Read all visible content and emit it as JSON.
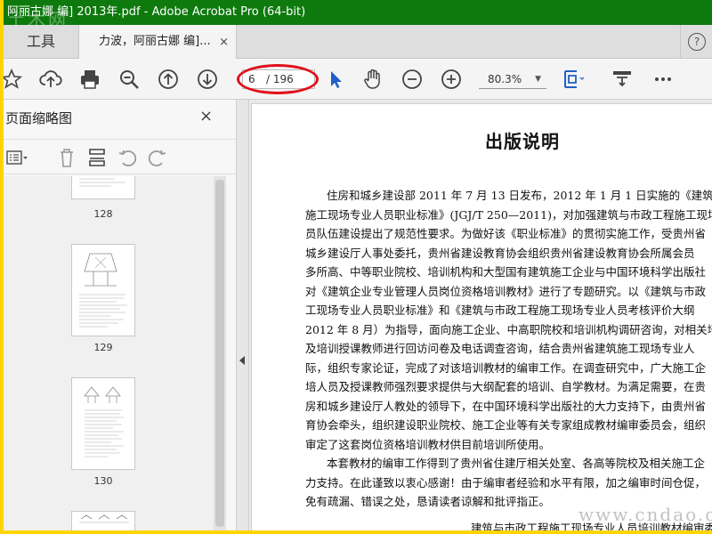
{
  "window": {
    "title": "阿丽古娜 编] 2013年.pdf - Adobe Acrobat Pro (64-bit)",
    "watermark_top": "土木网",
    "watermark_bottom": "www.cndao.com"
  },
  "tabs": {
    "tools_label": "工具",
    "doc_label": "力波，阿丽古娜 编]...",
    "close_glyph": "×",
    "help_glyph": "?"
  },
  "toolbar": {
    "page_current": "6",
    "page_total": "/ 196",
    "zoom_value": "80.3%",
    "icons": [
      "bookmark-star-icon",
      "upload-icon",
      "print-icon",
      "zoom-out-glass-icon",
      "page-up-icon",
      "page-down-icon",
      "select-cursor-icon",
      "hand-tool-icon",
      "zoom-minus-icon",
      "zoom-plus-icon",
      "fit-page-icon",
      "comment-tool-icon",
      "more-icon"
    ]
  },
  "sidebar": {
    "title": "页面缩略图",
    "close_glyph": "×",
    "thumbnails": [
      {
        "label": "128"
      },
      {
        "label": "129"
      },
      {
        "label": "130"
      }
    ]
  },
  "document": {
    "title": "出版说明",
    "paragraph1": [
      "住房和城乡建设部 2011 年 7 月 13 日发布，2012 年 1 月 1 日实施的《建筑与市",
      "施工现场专业人员职业标准》(JGJ/T 250—2011)，对加强建筑与市政工程施工现场",
      "员队伍建设提出了规范性要求。为做好该《职业标准》的贯彻实施工作，受贵州省",
      "城乡建设厅人事处委托，贵州省建设教育协会组织贵州省建设教育协会所属会员",
      "多所高、中等职业院校、培训机构和大型国有建筑施工企业与中国环境科学出版社",
      "对《建筑企业专业管理人员岗位资格培训教材》进行了专题研究。以《建筑与市政",
      "工现场专业人员职业标准》和《建筑与市政工程施工现场专业人员考核评价大纲",
      "2012 年 8 月）为指导，面向施工企业、中高职院校和培训机构调研咨询，对相关培",
      "及培训授课教师进行回访问卷及电话调查咨询，结合贵州省建筑施工现场专业人",
      "际，组织专家论证，完成了对该培训教材的编审工作。在调查研究中，广大施工企",
      "培人员及授课教师强烈要求提供与大纲配套的培训、自学教材。为满足需要，在贵",
      "房和城乡建设厅人教处的领导下，在中国环境科学出版社的大力支持下，由贵州省",
      "育协会牵头，组织建设职业院校、施工企业等有关专家组成教材编审委员会，组织",
      "审定了这套岗位资格培训教材供目前培训所使用。"
    ],
    "paragraph2": [
      "本套教材的编审工作得到了贵州省住建厅相关处室、各高等院校及相关施工企",
      "力支持。在此谨致以衷心感谢！由于编审者经验和水平有限，加之编审时间仓促，",
      "免有疏漏、错误之处，恳请读者谅解和批评指正。"
    ],
    "footer": "建筑与市政工程施工现场专业人员培训教材编审委"
  }
}
